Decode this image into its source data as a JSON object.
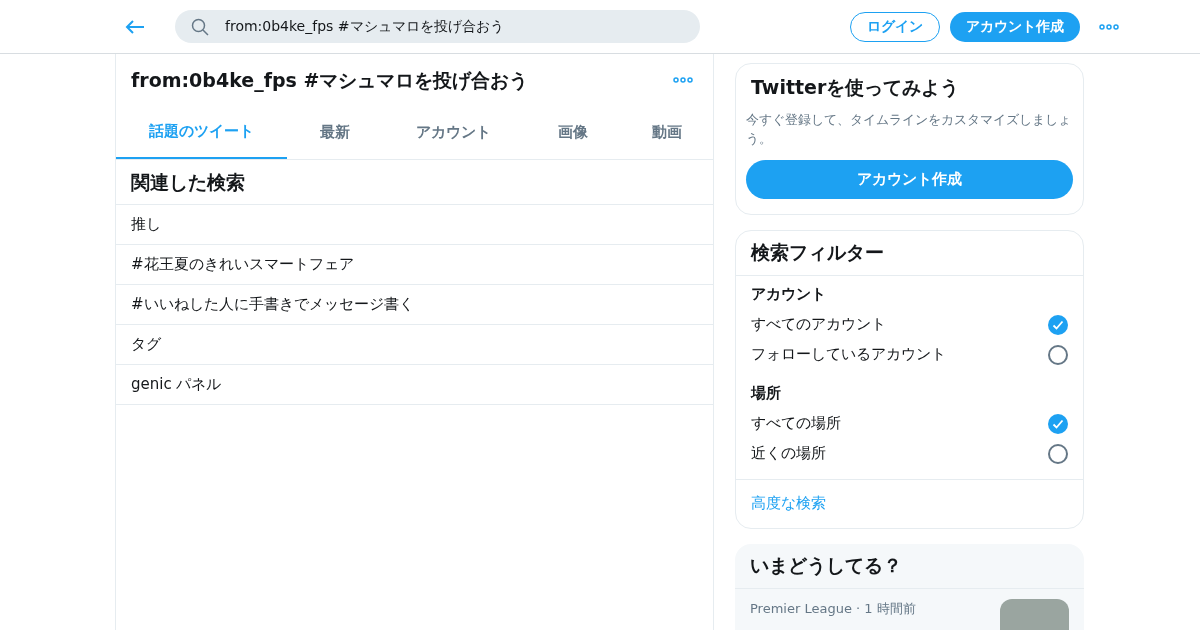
{
  "header": {
    "search": {
      "value": "from:0b4ke_fps #マシュマロを投げ合おう"
    },
    "login": "ログイン",
    "signup": "アカウント作成"
  },
  "main": {
    "title": "from:0b4ke_fps #マシュマロを投げ合おう",
    "tabs": [
      {
        "label": "話題のツイート",
        "selected": true
      },
      {
        "label": "最新",
        "selected": false
      },
      {
        "label": "アカウント",
        "selected": false
      },
      {
        "label": "画像",
        "selected": false
      },
      {
        "label": "動画",
        "selected": false
      }
    ],
    "related": {
      "title": "関連した検索",
      "items": [
        "推し",
        "#花王夏のきれいスマートフェア",
        "#いいねした人に手書きでメッセージ書く",
        "タグ",
        "genic パネル"
      ]
    }
  },
  "signup_card": {
    "title": "Twitterを使ってみよう",
    "text": "今すぐ登録して、タイムラインをカスタマイズしましょう。",
    "button": "アカウント作成"
  },
  "filters": {
    "title": "検索フィルター",
    "groups": [
      {
        "heading": "アカウント",
        "options": [
          {
            "label": "すべてのアカウント",
            "selected": true
          },
          {
            "label": "フォローしているアカウント",
            "selected": false
          }
        ]
      },
      {
        "heading": "場所",
        "options": [
          {
            "label": "すべての場所",
            "selected": true
          },
          {
            "label": "近くの場所",
            "selected": false
          }
        ]
      }
    ],
    "advanced": "高度な検索"
  },
  "trends": {
    "title": "いまどうしてる？",
    "items": [
      {
        "source": "Premier League",
        "separator": "·",
        "time": "1 時間前"
      }
    ]
  }
}
